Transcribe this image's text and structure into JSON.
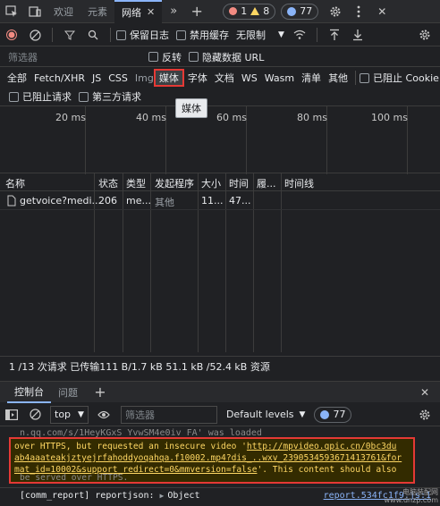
{
  "tabbar": {
    "tab_welcome": "欢迎",
    "tab_elements": "元素",
    "tab_network": "网络",
    "errors": "1",
    "warnings": "8",
    "issues": "77"
  },
  "toolbar": {
    "preserve_log": "保留日志",
    "disable_cache": "禁用缓存",
    "throttle": "无限制"
  },
  "filter": {
    "placeholder": "筛选器",
    "invert": "反转",
    "hide_data_urls": "隐藏数据 URL"
  },
  "types": [
    "全部",
    "Fetch/XHR",
    "JS",
    "CSS",
    "Img",
    "媒体",
    "字体",
    "文档",
    "WS",
    "Wasm",
    "清单",
    "其他"
  ],
  "block_cookies": "已阻止 Cookie",
  "blocked_requests": "已阻止请求",
  "third_party": "第三方请求",
  "tooltip": "媒体",
  "overview_ticks": [
    "20 ms",
    "40 ms",
    "60 ms",
    "80 ms",
    "100 ms"
  ],
  "table": {
    "headers": [
      "名称",
      "状态",
      "类型",
      "发起程序",
      "大小",
      "时间",
      "履...",
      "时间线"
    ],
    "rows": [
      {
        "name": "getvoice?medi...",
        "status": "206",
        "type": "me...",
        "initiator": "其他",
        "size": "11...",
        "time": "47..."
      }
    ]
  },
  "statusbar": "1 /13 次请求  已传输111 B/1.7 kB  51.1 kB /52.4 kB 资源",
  "drawer": {
    "tab_console": "控制台",
    "tab_issues": "问题",
    "context": "top",
    "filter_placeholder": "筛选器",
    "levels": "Default levels",
    "issues": "77"
  },
  "console": {
    "faded_top": "n.qq.com/s/1HeyKGxS_YvwSM4e0iv_FA' was loaded",
    "warn_1": "over HTTPS, but requested an insecure video '",
    "warn_link": "http://mpvideo.qpic.cn/0bc3duab4aaateakjztyejrfahoddyoqahqa.f10002.mp4?dis_k=...&dis_t=...&vid=wxv_2390534593671413761&format_id=10002&support_redirect=0&mmversion=false",
    "warn_link_l1": "http://mpvideo.qpic.cn/0bc3du",
    "warn_link_l2": "ab4aaateakjztyejrfahoddyoqahqa.f10002.mp4?dis_..wxv_2390534593671413761&for",
    "warn_link_l3": "mat_id=10002&support_redirect=0&mmversion=false",
    "warn_2": "'. This content should also",
    "faded_bottom": "be served over HTTPS.",
    "log_prefix": "[comm_report] reportjson:",
    "log_object": "Object",
    "log_source": "report.534fc1f9.js:1"
  },
  "watermark": [
    "电脑装配网",
    "www.dnzp.com"
  ]
}
